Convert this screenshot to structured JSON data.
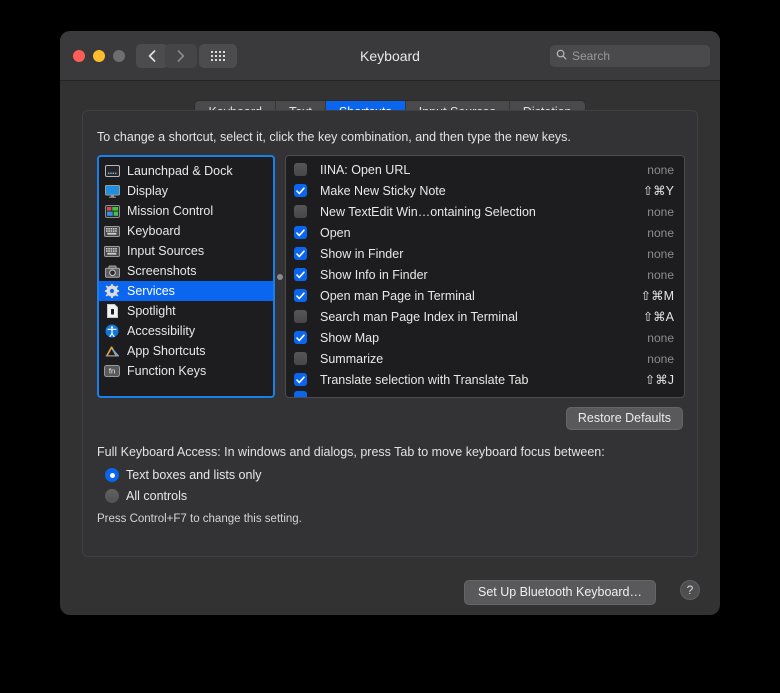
{
  "window": {
    "title": "Keyboard",
    "traffic_lights": [
      "close",
      "minimize",
      "zoom"
    ],
    "back_label": "‹",
    "forward_label": "›",
    "grid_label": "show-all-grid"
  },
  "search": {
    "placeholder": "Search",
    "value": ""
  },
  "tabs": [
    {
      "label": "Keyboard",
      "active": false
    },
    {
      "label": "Text",
      "active": false
    },
    {
      "label": "Shortcuts",
      "active": true
    },
    {
      "label": "Input Sources",
      "active": false
    },
    {
      "label": "Dictation",
      "active": false
    }
  ],
  "instruction": "To change a shortcut, select it, click the key combination, and then type the new keys.",
  "categories": [
    {
      "label": "Launchpad & Dock",
      "icon": "launchpad-dock-icon",
      "selected": false
    },
    {
      "label": "Display",
      "icon": "display-icon",
      "selected": false
    },
    {
      "label": "Mission Control",
      "icon": "mission-control-icon",
      "selected": false
    },
    {
      "label": "Keyboard",
      "icon": "keyboard-icon",
      "selected": false
    },
    {
      "label": "Input Sources",
      "icon": "input-sources-icon",
      "selected": false
    },
    {
      "label": "Screenshots",
      "icon": "screenshots-icon",
      "selected": false
    },
    {
      "label": "Services",
      "icon": "services-gear-icon",
      "selected": true
    },
    {
      "label": "Spotlight",
      "icon": "spotlight-icon",
      "selected": false
    },
    {
      "label": "Accessibility",
      "icon": "accessibility-icon",
      "selected": false
    },
    {
      "label": "App Shortcuts",
      "icon": "app-shortcuts-icon",
      "selected": false
    },
    {
      "label": "Function Keys",
      "icon": "function-keys-icon",
      "selected": false
    }
  ],
  "shortcuts": [
    {
      "name": "IINA: Open URL",
      "checked": false,
      "key": "none",
      "key_set": false
    },
    {
      "name": "Make New Sticky Note",
      "checked": true,
      "key": "⇧⌘Y",
      "key_set": true
    },
    {
      "name": "New TextEdit Win…ontaining Selection",
      "checked": false,
      "key": "none",
      "key_set": false
    },
    {
      "name": "Open",
      "checked": true,
      "key": "none",
      "key_set": false
    },
    {
      "name": "Show in Finder",
      "checked": true,
      "key": "none",
      "key_set": false
    },
    {
      "name": "Show Info in Finder",
      "checked": true,
      "key": "none",
      "key_set": false
    },
    {
      "name": "Open man Page in Terminal",
      "checked": true,
      "key": "⇧⌘M",
      "key_set": true
    },
    {
      "name": "Search man Page Index in Terminal",
      "checked": false,
      "key": "⇧⌘A",
      "key_set": true
    },
    {
      "name": "Show Map",
      "checked": true,
      "key": "none",
      "key_set": false
    },
    {
      "name": "Summarize",
      "checked": false,
      "key": "none",
      "key_set": false
    },
    {
      "name": "Translate selection with Translate Tab",
      "checked": true,
      "key": "⇧⌘J",
      "key_set": true
    }
  ],
  "restore_defaults_label": "Restore Defaults",
  "full_keyboard_access": {
    "label": "Full Keyboard Access: In windows and dialogs, press Tab to move keyboard focus between:",
    "options": [
      {
        "label": "Text boxes and lists only",
        "selected": true
      },
      {
        "label": "All controls",
        "selected": false
      }
    ],
    "hint": "Press Control+F7 to change this setting."
  },
  "footer": {
    "setup_bluetooth_label": "Set Up Bluetooth Keyboard…",
    "help_label": "?"
  },
  "colors": {
    "accent": "#0a66ef",
    "window_bg": "#323232",
    "panel_bg": "#333335",
    "list_bg": "#1d1d1f",
    "focus_ring": "#1a7fe8"
  }
}
